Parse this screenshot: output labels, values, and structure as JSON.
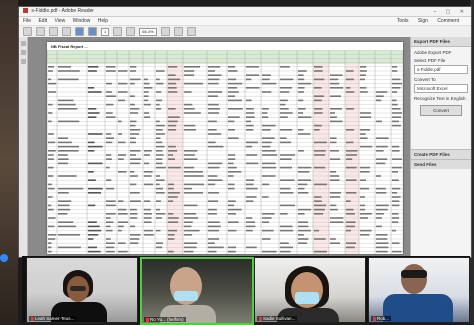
{
  "window": {
    "title": "s-Fiddle.pdf - Adobe Reader",
    "controls": "– ▢ ✕"
  },
  "menu": [
    "File",
    "Edit",
    "View",
    "Window",
    "Help"
  ],
  "right_tabs": [
    "Tools",
    "Sign",
    "Comment"
  ],
  "toolbar": {
    "page_field": "1",
    "zoom_field": "66.4%"
  },
  "document": {
    "sheet_title": "NB Fiscal Report ..."
  },
  "panel": {
    "header": "Export PDF Files",
    "subtitle": "Adobe Export PDF",
    "select_label": "Select PDF File",
    "file_name": "s-Fiddle.pdf",
    "convert_label": "Convert To",
    "format_value": "Microsoft Excel",
    "recognize_label": "Recognize Text in English",
    "convert_button": "Convert",
    "footer_1": "Create PDF Files",
    "footer_2": "Send Files"
  },
  "participants": [
    {
      "name": "Leah Samer-Teus..."
    },
    {
      "name": "Ro Yu... (he/him)"
    },
    {
      "name": "Sadie Sullivan..."
    },
    {
      "name": "Rob..."
    }
  ]
}
